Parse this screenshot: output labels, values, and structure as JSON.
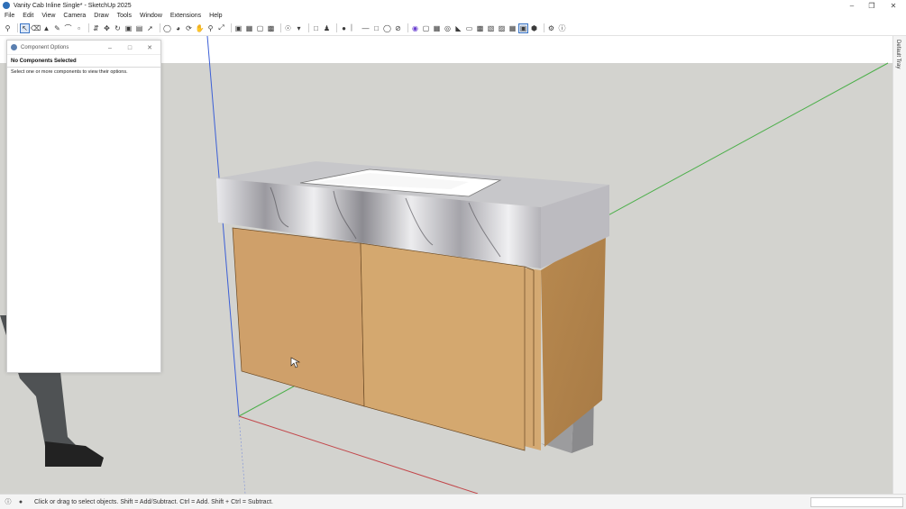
{
  "window": {
    "title": "Vanity Cab Inline Single* - SketchUp 2025"
  },
  "menu": [
    "File",
    "Edit",
    "View",
    "Camera",
    "Draw",
    "Tools",
    "Window",
    "Extensions",
    "Help"
  ],
  "toolbar": {
    "tools": [
      "zoom",
      "select",
      "eraser",
      "paint-bucket",
      "pencil",
      "arc",
      "rectangle",
      "push-pull",
      "move",
      "rotate",
      "scale",
      "offset",
      "follow-me",
      "tape-measure",
      "protractor",
      "text",
      "dimension",
      "orbit",
      "pan",
      "zoom-window",
      "zoom-extents",
      "xray",
      "back-edges",
      "wireframe",
      "hidden-line",
      "shaded",
      "textured",
      "monochrome",
      "section-plane",
      "display-section",
      "new-document",
      "add-person",
      "dot",
      "line-style",
      "axes",
      "hide",
      "profile",
      "component",
      "group",
      "camera",
      "iso",
      "top",
      "front",
      "right",
      "back",
      "left",
      "perspective",
      "help"
    ]
  },
  "component_options": {
    "title": "Component Options",
    "heading": "No Components Selected",
    "body": "Select one or more components to view their options."
  },
  "tray": {
    "label": "Default Tray"
  },
  "status": {
    "hint": "Click or drag to select objects. Shift = Add/Subtract. Ctrl = Add. Shift + Ctrl = Subtract."
  },
  "colors": {
    "ground": "#d3d3cf",
    "sky": "#ffffff",
    "wood": "#c89a62",
    "marble": "#d8d8da",
    "axis_red": "#c2474b",
    "axis_green": "#4caf4a",
    "axis_blue": "#3c5fd6"
  }
}
